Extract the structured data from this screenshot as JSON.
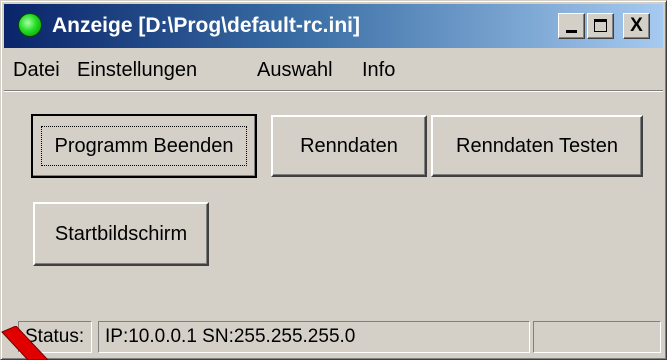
{
  "window": {
    "title": "Anzeige [D:\\Prog\\default-rc.ini]",
    "title_controls": {
      "minimize": "_",
      "maximize": "□",
      "close": "X"
    }
  },
  "menu": {
    "items": [
      "Datei",
      "Einstellungen",
      "Auswahl",
      "Info"
    ]
  },
  "buttons": {
    "quit": "Programm Beenden",
    "race_data": "Renndaten",
    "test_race_data": "Renndaten Testen",
    "start_screen": "Startbildschirm"
  },
  "status": {
    "label": "Status:",
    "connection": "IP:10.0.0.1 SN:255.255.255.0",
    "extra": ""
  },
  "colors": {
    "window_bg": "#d4d0c8",
    "titlebar_start": "#0a246a",
    "titlebar_end": "#a6caf0",
    "app_icon": "#22dd22",
    "cursor": "#e00000"
  },
  "icons": {
    "app": "green-circle-icon",
    "cursor": "mouse-pointer-icon"
  }
}
